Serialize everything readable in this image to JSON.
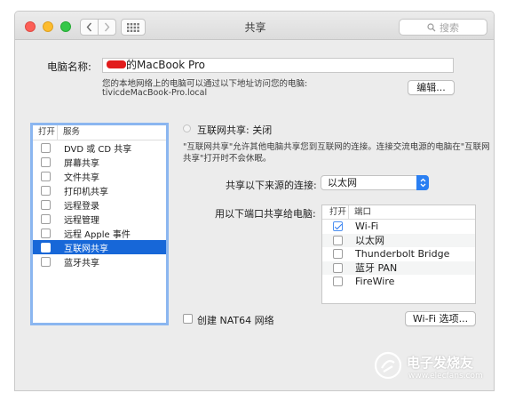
{
  "window": {
    "title": "共享",
    "search_placeholder": "搜索"
  },
  "computer_name": {
    "label": "电脑名称:",
    "value": "的MacBook Pro",
    "description": "您的本地网络上的电脑可以通过以下地址访问您的电脑:",
    "address": "tivicdeMacBook-Pro.local",
    "edit_button": "编辑..."
  },
  "services": {
    "col_on": "打开",
    "col_service": "服务",
    "items": [
      {
        "label": "DVD 或 CD 共享",
        "checked": false,
        "selected": false
      },
      {
        "label": "屏幕共享",
        "checked": false,
        "selected": false
      },
      {
        "label": "文件共享",
        "checked": false,
        "selected": false
      },
      {
        "label": "打印机共享",
        "checked": false,
        "selected": false
      },
      {
        "label": "远程登录",
        "checked": false,
        "selected": false
      },
      {
        "label": "远程管理",
        "checked": false,
        "selected": false
      },
      {
        "label": "远程 Apple 事件",
        "checked": false,
        "selected": false
      },
      {
        "label": "互联网共享",
        "checked": false,
        "selected": true
      },
      {
        "label": "蓝牙共享",
        "checked": false,
        "selected": false
      }
    ]
  },
  "internet_sharing": {
    "status": "互联网共享: 关闭",
    "description_line1": "\"互联网共享\"允许其他电脑共享您到互联网的连接。连接交流电源的电脑在\"互联网",
    "description_line2": "共享\"打开时不会休眠。",
    "from_label": "共享以下来源的连接:",
    "from_value": "以太网",
    "to_label": "用以下端口共享给电脑:",
    "ports_col_on": "打开",
    "ports_col_port": "端口",
    "ports": [
      {
        "label": "Wi-Fi",
        "checked": true
      },
      {
        "label": "以太网",
        "checked": false
      },
      {
        "label": "Thunderbolt Bridge",
        "checked": false
      },
      {
        "label": "蓝牙 PAN",
        "checked": false
      },
      {
        "label": "FireWire",
        "checked": false
      }
    ],
    "nat64_label": "创建 NAT64 网络",
    "wifi_options_button": "Wi-Fi 选项..."
  },
  "watermark": {
    "text": "电子发烧友",
    "url": "www.elecfans.com"
  },
  "colors": {
    "selection": "#1767d8",
    "accent": "#2a7ff2",
    "list_focus_ring": "#8bb6f0",
    "redaction": "#e21c1c"
  }
}
